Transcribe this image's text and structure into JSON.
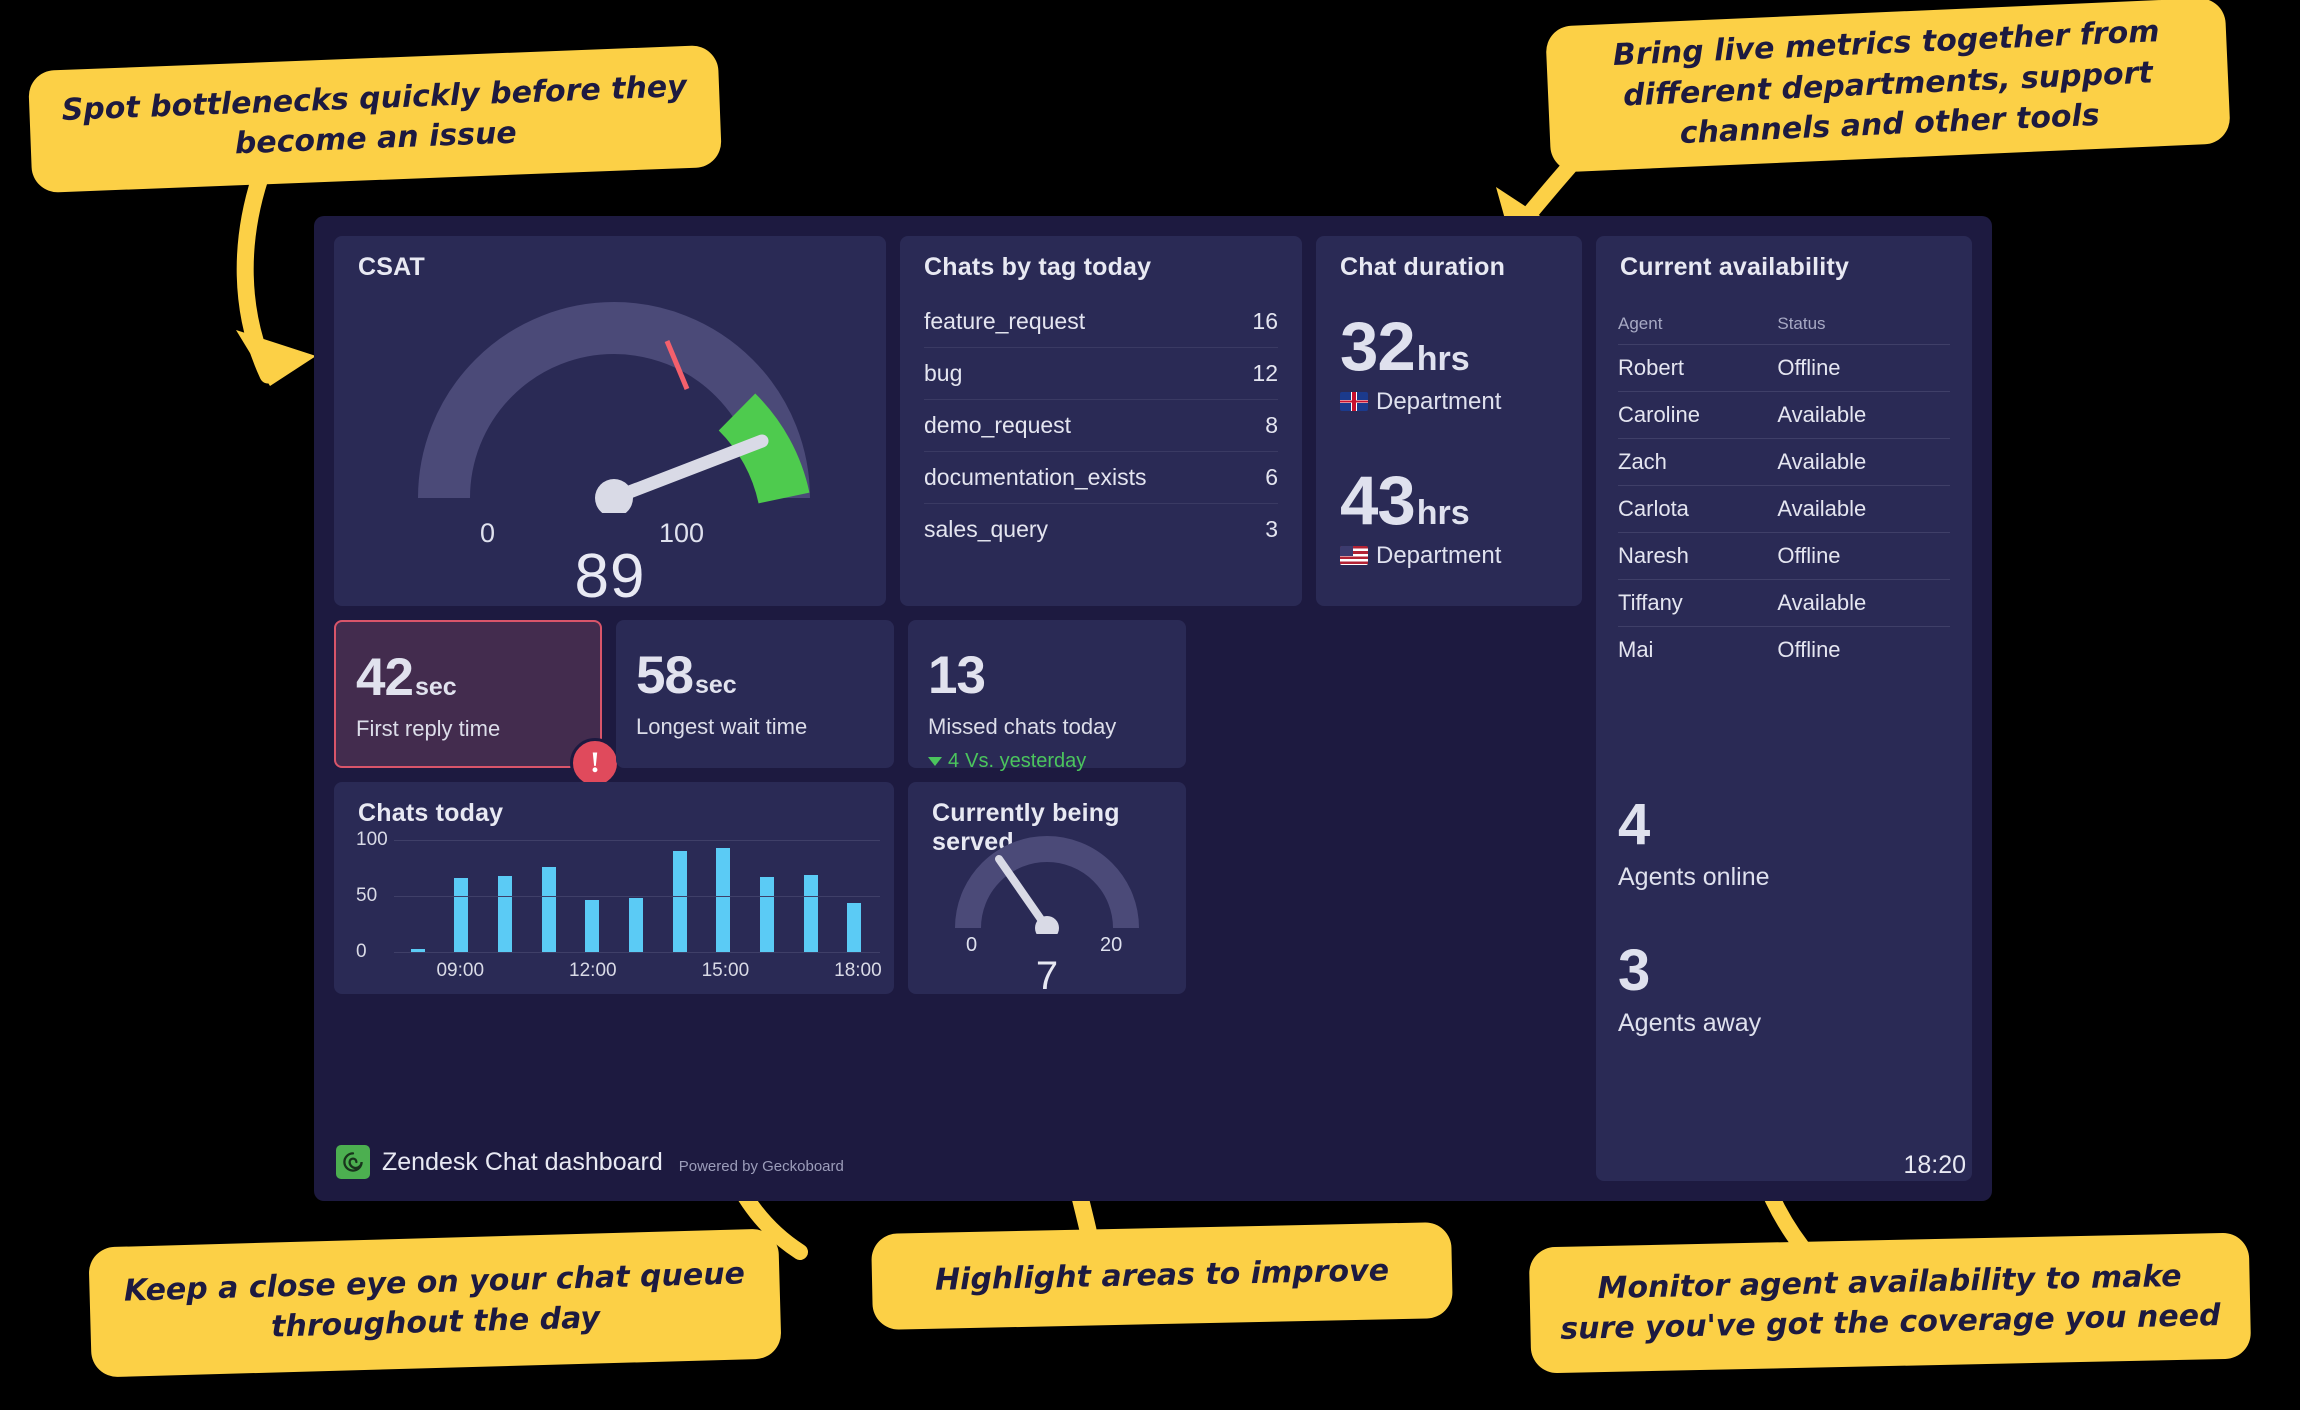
{
  "dashboard": {
    "footer": {
      "title": "Zendesk Chat dashboard",
      "powered_by": "Powered by Geckoboard",
      "time": "18:20",
      "logo_color": "#4caf50"
    },
    "csat": {
      "title": "CSAT",
      "value": "89",
      "min_label": "0",
      "max_label": "100",
      "min": 0,
      "max": 100,
      "needle_value": 89,
      "goal_marker": 70,
      "band_start": 85,
      "band_color": "#4ecb4e",
      "track_color": "#4b4a78",
      "marker_color": "#f4606c"
    },
    "chats_by_tag": {
      "title": "Chats by tag today",
      "rows": [
        {
          "tag": "feature_request",
          "count": "16"
        },
        {
          "tag": "bug",
          "count": "12"
        },
        {
          "tag": "demo_request",
          "count": "8"
        },
        {
          "tag": "documentation_exists",
          "count": "6"
        },
        {
          "tag": "sales_query",
          "count": "3"
        }
      ]
    },
    "chat_duration": {
      "title": "Chat duration",
      "items": [
        {
          "value": "32",
          "unit": "hrs",
          "label": "Department",
          "flag": "gb-flag-icon"
        },
        {
          "value": "43",
          "unit": "hrs",
          "label": "Department",
          "flag": "us-flag-icon"
        }
      ]
    },
    "current_availability": {
      "title": "Current availability",
      "columns": [
        "Agent",
        "Status"
      ],
      "rows": [
        {
          "agent": "Robert",
          "status": "Offline"
        },
        {
          "agent": "Caroline",
          "status": "Available"
        },
        {
          "agent": "Zach",
          "status": "Available"
        },
        {
          "agent": "Carlota",
          "status": "Available"
        },
        {
          "agent": "Naresh",
          "status": "Offline"
        },
        {
          "agent": "Tiffany",
          "status": "Available"
        },
        {
          "agent": "Mai",
          "status": "Offline"
        }
      ],
      "agents_online": {
        "value": "4",
        "label": "Agents online"
      },
      "agents_away": {
        "value": "3",
        "label": "Agents away"
      }
    },
    "first_reply_time": {
      "value": "42",
      "unit": "sec",
      "label": "First reply time",
      "alert": true,
      "alert_glyph": "!",
      "border_color": "#d9556a",
      "background_color": "#432c4e"
    },
    "longest_wait_time": {
      "value": "58",
      "unit": "sec",
      "label": "Longest wait time"
    },
    "missed_chats": {
      "value": "13",
      "label": "Missed chats today",
      "delta_value": "4",
      "delta_suffix": "Vs. yesterday",
      "delta_direction": "down",
      "delta_color": "#4bc55d"
    },
    "currently_being_served": {
      "title": "Currently being served",
      "value": "7",
      "min_label": "0",
      "max_label": "20",
      "min": 0,
      "max": 20,
      "needle_value": 7,
      "track_color": "#4b4a78"
    }
  },
  "chart_data": {
    "type": "bar",
    "title": "Chats today",
    "xlabel": "",
    "ylabel": "",
    "ylim": [
      0,
      100
    ],
    "yticks": [
      "0",
      "50",
      "100"
    ],
    "grid": true,
    "legend": "none",
    "bar_color": "#5bcbf5",
    "xtick_labels": [
      "09:00",
      "12:00",
      "15:00",
      "18:00"
    ],
    "xtick_positions": [
      1,
      4,
      7,
      10
    ],
    "categories": [
      "07:00",
      "08:00",
      "09:00",
      "10:00",
      "11:00",
      "12:00",
      "13:00",
      "14:00",
      "15:00",
      "16:00",
      "17:00"
    ],
    "values": [
      2,
      66,
      68,
      76,
      46,
      48,
      90,
      93,
      67,
      69,
      44
    ]
  },
  "callouts": [
    {
      "id": "callout-1",
      "text": "Spot bottlenecks quickly before they become an issue"
    },
    {
      "id": "callout-2",
      "text": "Bring live metrics together from different departments, support channels and other tools"
    },
    {
      "id": "callout-3",
      "text": "Keep a close eye on your chat queue throughout the day"
    },
    {
      "id": "callout-4",
      "text": "Highlight areas to improve"
    },
    {
      "id": "callout-5",
      "text": "Monitor agent availability to make sure you've got the coverage you need"
    }
  ],
  "annotation_color": "#fcd046"
}
